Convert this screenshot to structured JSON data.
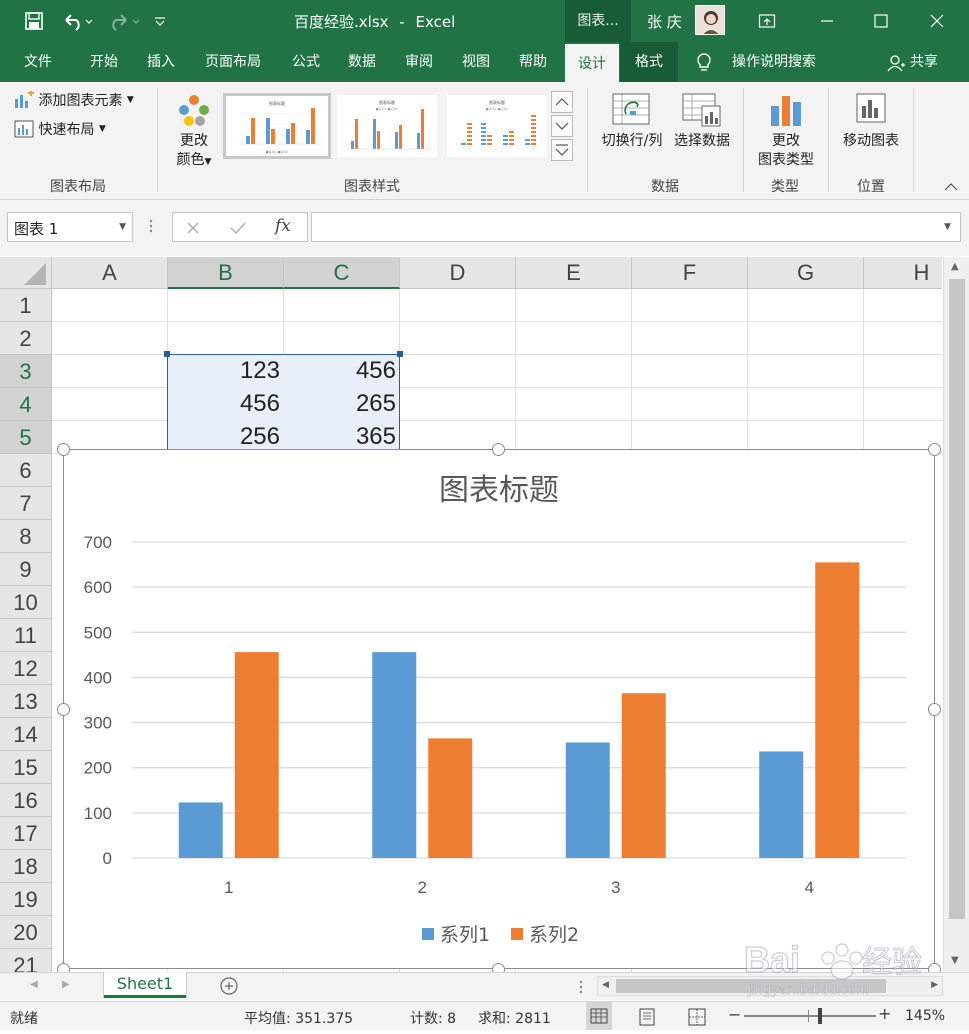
{
  "title_bar": {
    "file_title": "百度经验.xlsx",
    "separator": "-",
    "app_name": "Excel",
    "context_tab": "图表...",
    "user_name": "张 庆"
  },
  "menu": {
    "tabs": [
      "文件",
      "开始",
      "插入",
      "页面布局",
      "公式",
      "数据",
      "审阅",
      "视图",
      "帮助"
    ],
    "design": "设计",
    "format": "格式",
    "tell_me": "操作说明搜索",
    "share": "共享"
  },
  "ribbon": {
    "add_element": "添加图表元素",
    "quick_layout": "快速布局",
    "group_layout": "图表布局",
    "change_colors_1": "更改",
    "change_colors_2": "颜色",
    "group_styles": "图表样式",
    "switch_rowcol": "切换行/列",
    "select_data": "选择数据",
    "group_data": "数据",
    "change_type_1": "更改",
    "change_type_2": "图表类型",
    "group_type": "类型",
    "move_chart": "移动图表",
    "group_location": "位置"
  },
  "formula_bar": {
    "name_box": "图表 1",
    "fx": "fx",
    "value": ""
  },
  "columns": [
    "A",
    "B",
    "C",
    "D",
    "E",
    "F",
    "G",
    "H"
  ],
  "rows": [
    "1",
    "2",
    "3",
    "4",
    "5",
    "6",
    "7",
    "8",
    "9",
    "10",
    "11",
    "12",
    "13",
    "14",
    "15",
    "16",
    "17",
    "18",
    "19",
    "20",
    "21"
  ],
  "cells": {
    "B3": "123",
    "C3": "456",
    "B4": "456",
    "C4": "265",
    "B5": "256",
    "C5": "365"
  },
  "chart_data": {
    "type": "bar",
    "title": "图表标题",
    "categories": [
      "1",
      "2",
      "3",
      "4"
    ],
    "series": [
      {
        "name": "系列1",
        "values": [
          123,
          456,
          256,
          236
        ],
        "color": "#5b9bd5"
      },
      {
        "name": "系列2",
        "values": [
          456,
          265,
          365,
          655
        ],
        "color": "#ed7d31"
      }
    ],
    "ylim": [
      0,
      700
    ],
    "yticks": [
      "0",
      "100",
      "200",
      "300",
      "400",
      "500",
      "600",
      "700"
    ],
    "grid": true,
    "legend": "bottom"
  },
  "sheets": {
    "active": "Sheet1"
  },
  "status": {
    "ready": "就绪",
    "average": "平均值: 351.375",
    "count": "计数: 8",
    "sum": "求和: 2811",
    "zoom": "145%"
  },
  "icons": {
    "save": "save-icon",
    "undo": "undo-icon",
    "redo": "redo-icon",
    "customize": "customize-qat-icon",
    "ribbon_display": "ribbon-display-icon",
    "minimize": "minimize-icon",
    "maximize": "maximize-icon",
    "close": "close-icon",
    "lightbulb": "lightbulb-icon",
    "share": "person-icon"
  },
  "colors": {
    "excel_green": "#217346",
    "context_green": "#185c37",
    "series1": "#5b9bd5",
    "series2": "#ed7d31",
    "selection": "#e8eefa",
    "selection_border": "#2e5c9a"
  }
}
